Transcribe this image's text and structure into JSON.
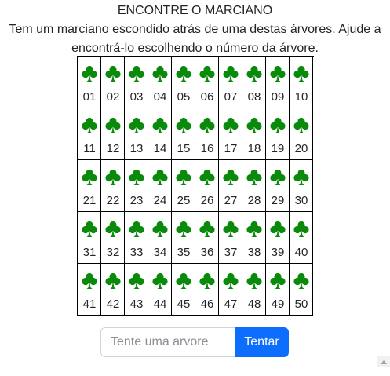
{
  "header": {
    "title": "ENCONTRE O MARCIANO",
    "instructions": "Tem um marciano escondido atrás de uma destas árvores. Ajude a encontrá-lo escolhendo o número da árvore."
  },
  "tree_icon": "club-tree-icon",
  "tree_color": "#0a8a0a",
  "trees": [
    "01",
    "02",
    "03",
    "04",
    "05",
    "06",
    "07",
    "08",
    "09",
    "10",
    "11",
    "12",
    "13",
    "14",
    "15",
    "16",
    "17",
    "18",
    "19",
    "20",
    "21",
    "22",
    "23",
    "24",
    "25",
    "26",
    "27",
    "28",
    "29",
    "30",
    "31",
    "32",
    "33",
    "34",
    "35",
    "36",
    "37",
    "38",
    "39",
    "40",
    "41",
    "42",
    "43",
    "44",
    "45",
    "46",
    "47",
    "48",
    "49",
    "50"
  ],
  "guess_form": {
    "placeholder": "Tente uma arvore",
    "value": "",
    "button_label": "Tentar",
    "button_color": "#0d6efd"
  },
  "scrollbar": {
    "icon": "scroll-up-arrow-icon"
  }
}
